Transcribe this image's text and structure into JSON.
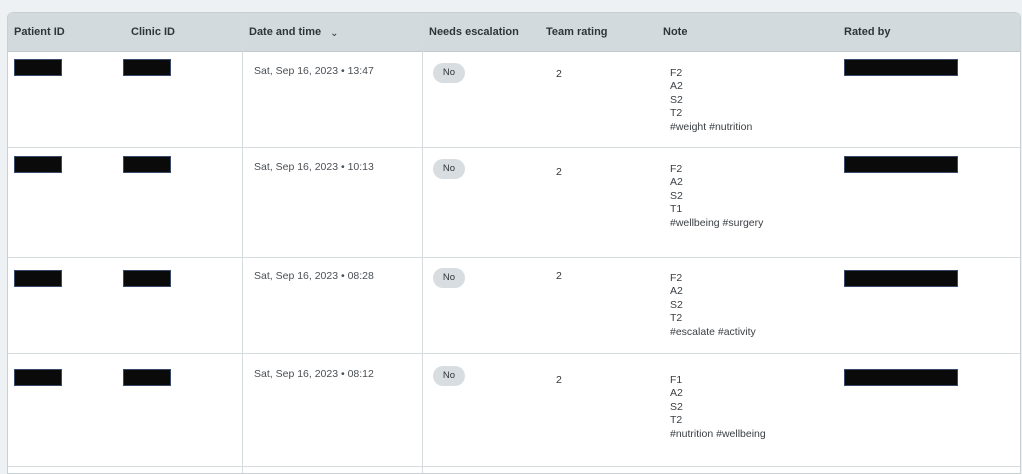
{
  "columns": {
    "patient_id": "Patient ID",
    "clinic_id": "Clinic ID",
    "date_time": "Date and time",
    "needs_escalation": "Needs escalation",
    "team_rating": "Team rating",
    "note": "Note",
    "rated_by": "Rated by"
  },
  "rows": [
    {
      "datetime": "Sat, Sep 16, 2023 • 13:47",
      "escalation": "No",
      "rating": "2",
      "note": [
        "F2",
        "A2",
        "S2",
        "T2",
        "#weight #nutrition"
      ]
    },
    {
      "datetime": "Sat, Sep 16, 2023 • 10:13",
      "escalation": "No",
      "rating": "2",
      "note": [
        "F2",
        "A2",
        "S2",
        "T1",
        "#wellbeing #surgery"
      ]
    },
    {
      "datetime": "Sat, Sep 16, 2023 • 08:28",
      "escalation": "No",
      "rating": "2",
      "note": [
        "F2",
        "A2",
        "S2",
        "T2",
        "#escalate #activity"
      ]
    },
    {
      "datetime": "Sat, Sep 16, 2023 • 08:12",
      "escalation": "No",
      "rating": "2",
      "note": [
        "F1",
        "A2",
        "S2",
        "T2",
        "#nutrition #wellbeing"
      ]
    }
  ],
  "colors": {
    "header_bg": "#d3dade",
    "pill_bg": "#d7dde1",
    "redaction": "#0a0a0a",
    "page_bg": "#eef1f3"
  },
  "icons": {
    "sort": "chevron-down-icon"
  }
}
